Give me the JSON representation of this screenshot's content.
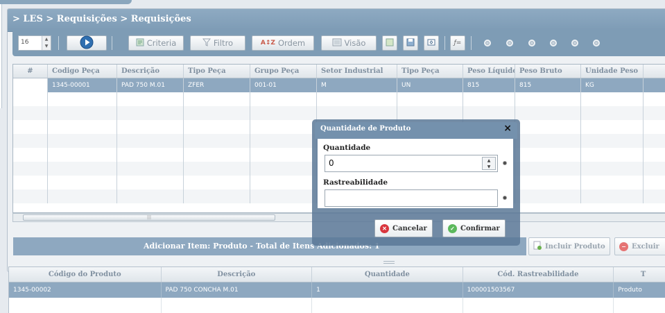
{
  "breadcrumb": "> LES > Requisições > Requisições",
  "toolbar": {
    "page_size": "16",
    "criteria_label": "Criteria",
    "filtro_label": "Filtro",
    "ordem_label": "Ordem",
    "visao_label": "Visão"
  },
  "grid": {
    "columns": [
      "#",
      "Codigo Peça",
      "Descrição",
      "Tipo Peça",
      "Grupo Peça",
      "Setor Industrial",
      "Tipo Peça",
      "Peso Líquido",
      "Peso Bruto",
      "Unidade Peso"
    ],
    "rows": [
      [
        "",
        "1345-00001",
        "PAD 750 M.01",
        "ZFER",
        "001-01",
        "M",
        "UN",
        "815",
        "815",
        "KG"
      ]
    ]
  },
  "add_bar": {
    "label": "Adicionar Item: Produto - Total de Itens Adicionados: 1"
  },
  "actions": {
    "incluir_label": "Incluir Produto",
    "excluir_label": "Excluir"
  },
  "lower_grid": {
    "columns": [
      "Código do Produto",
      "Descrição",
      "Quantidade",
      "Cód. Rastreabilidade",
      "T"
    ],
    "rows": [
      [
        "1345-00002",
        "PAD 750 CONCHA M.01",
        "1",
        "100001503567",
        "Produto"
      ]
    ]
  },
  "modal": {
    "title": "Quantidade de Produto",
    "close_icon": "×",
    "quantidade_label": "Quantidade",
    "quantidade_value": "0",
    "rastreabilidade_label": "Rastreabilidade",
    "rastreabilidade_value": "",
    "cancel_label": "Cancelar",
    "confirm_label": "Confirmar"
  },
  "colors": {
    "header": "#7d9bb5",
    "selected_row": "#8ea8c0",
    "modal_title": "#7491ad",
    "cancel_icon": "#d9363e",
    "confirm_icon": "#5cb85c"
  }
}
